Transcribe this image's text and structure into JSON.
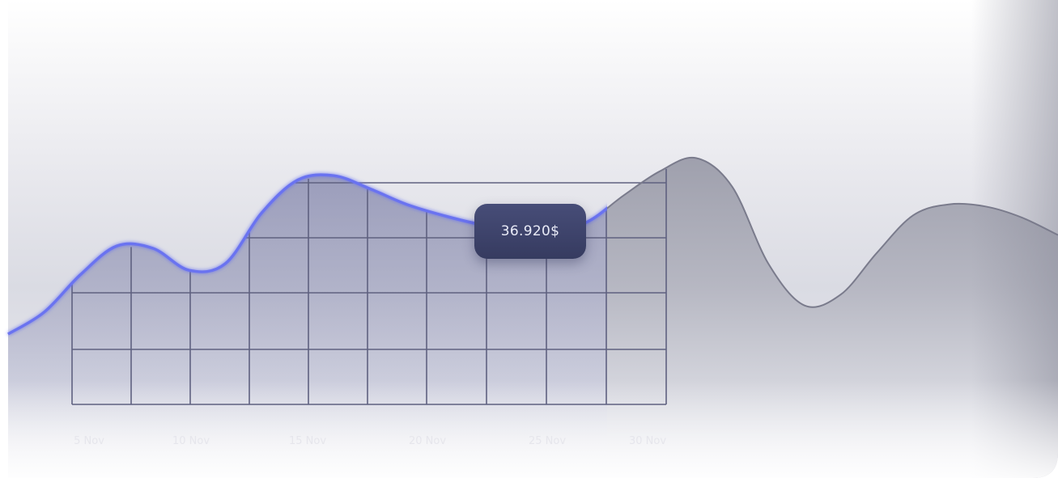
{
  "chart_data": {
    "type": "area",
    "title": "",
    "xlabel": "",
    "ylabel": "",
    "x_tick_labels": [
      "5 Nov",
      "10 Nov",
      "15 Nov",
      "20 Nov",
      "25 Nov",
      "30 Nov"
    ],
    "grid": true,
    "series": [
      {
        "points": [
          {
            "x": 0,
            "y": 8.6
          },
          {
            "x": 1,
            "y": 10.6
          },
          {
            "x": 2,
            "y": 14.0
          },
          {
            "x": 3,
            "y": 16.6
          },
          {
            "x": 4,
            "y": 16.4
          },
          {
            "x": 5,
            "y": 14.4
          },
          {
            "x": 6,
            "y": 15.0
          },
          {
            "x": 7,
            "y": 19.6
          },
          {
            "x": 8,
            "y": 22.6
          },
          {
            "x": 9,
            "y": 23.0
          },
          {
            "x": 10,
            "y": 21.8
          },
          {
            "x": 11,
            "y": 20.4
          },
          {
            "x": 12,
            "y": 19.4
          },
          {
            "x": 13,
            "y": 18.6
          },
          {
            "x": 14,
            "y": 18.2
          },
          {
            "x": 15,
            "y": 18.0
          },
          {
            "x": 16,
            "y": 18.8
          },
          {
            "x": 17,
            "y": 21.2
          },
          {
            "x": 18,
            "y": 23.4
          },
          {
            "x": 19,
            "y": 24.6
          },
          {
            "x": 20,
            "y": 22.0
          },
          {
            "x": 21,
            "y": 15.0
          },
          {
            "x": 22,
            "y": 11.2
          },
          {
            "x": 23,
            "y": 12.2
          },
          {
            "x": 24,
            "y": 16.0
          },
          {
            "x": 25,
            "y": 19.4
          },
          {
            "x": 26,
            "y": 20.4
          },
          {
            "x": 27,
            "y": 20.2
          },
          {
            "x": 28,
            "y": 19.2
          },
          {
            "x": 29,
            "y": 17.6
          }
        ],
        "highlight_until_index": 18
      }
    ],
    "tooltip": {
      "value": "36.920$",
      "x_index": 16
    }
  },
  "colors": {
    "line_highlight": "#6b73f0",
    "line_rest": "#7a7b8c",
    "grid": "#5f6180",
    "tooltip_bg": "#3d4269",
    "tooltip_text": "#e9ebf7",
    "tick_label": "#e6e6ec"
  }
}
